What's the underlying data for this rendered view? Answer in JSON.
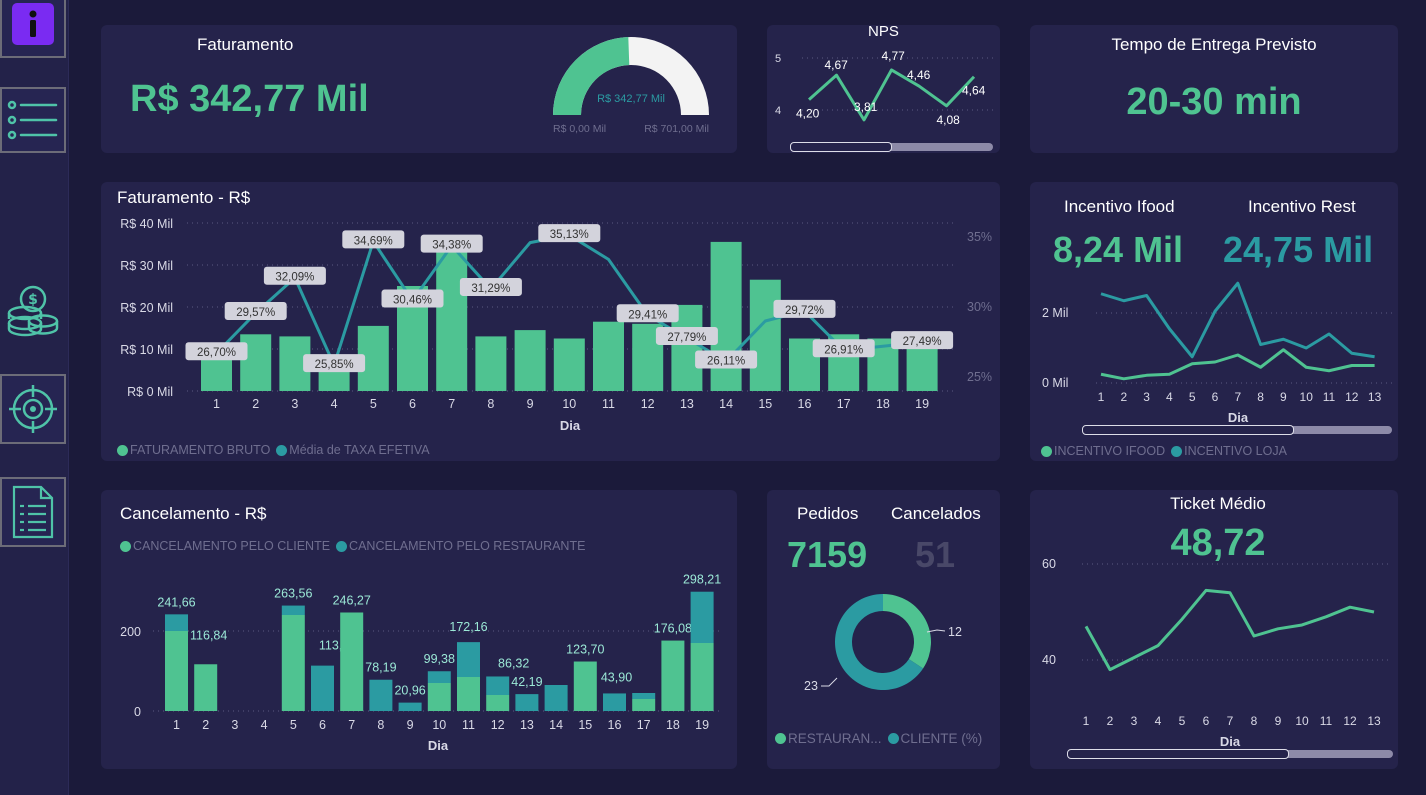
{
  "sidebar": {
    "icons": [
      "info-icon",
      "list-icon",
      "coins-icon",
      "target-icon",
      "document-icon"
    ]
  },
  "faturamento_card": {
    "title": "Faturamento",
    "value": "R$ 342,77 Mil",
    "gauge": {
      "value_label": "R$ 342,77 Mil",
      "min_label": "R$ 0,00 Mil",
      "max_label": "R$ 701,00 Mil",
      "value": 342.77,
      "min": 0,
      "max": 701
    }
  },
  "nps_card": {
    "title": "NPS",
    "y_ticks": [
      "5",
      "4"
    ],
    "chart_data": {
      "type": "line",
      "values": [
        4.2,
        4.67,
        3.81,
        4.77,
        4.46,
        4.08,
        4.64
      ],
      "point_labels": [
        "4,20",
        "4,67",
        "3,81",
        "4,77",
        "4,46",
        "4,08",
        "4,64"
      ],
      "ylim": [
        3.5,
        5.1
      ]
    },
    "scroll_fraction": 0.5
  },
  "tempo_card": {
    "title": "Tempo de Entrega Previsto",
    "value": "20-30 min"
  },
  "fat_chart_card": {
    "title": "Faturamento - R$",
    "xlabel": "Dia",
    "legend": [
      {
        "label": "FATURAMENTO BRUTO",
        "color": "#4fc391"
      },
      {
        "label": "Média de TAXA EFETIVA",
        "color": "#2b9ba2"
      }
    ],
    "chart_data": {
      "type": "bar+line",
      "categories": [
        "1",
        "2",
        "3",
        "4",
        "5",
        "6",
        "7",
        "8",
        "9",
        "10",
        "11",
        "12",
        "13",
        "14",
        "15",
        "16",
        "17",
        "18",
        "19"
      ],
      "y_ticks": [
        "R$ 40 Mil",
        "R$ 30 Mil",
        "R$ 20 Mil",
        "R$ 10 Mil",
        "R$ 0 Mil"
      ],
      "y2_ticks": [
        "35%",
        "30%",
        "25%"
      ],
      "ylim": [
        0,
        40
      ],
      "y2lim": [
        25,
        35
      ],
      "series": [
        {
          "name": "FATURAMENTO BRUTO",
          "values": [
            10.5,
            13.5,
            13,
            7.5,
            15.5,
            25,
            37,
            13,
            14.5,
            12.5,
            16.5,
            16,
            20.5,
            35.5,
            26.5,
            12.5,
            13.5,
            12.5,
            13
          ]
        },
        {
          "name": "Média de TAXA EFETIVA",
          "values": [
            26.7,
            29.57,
            32.09,
            25.85,
            34.69,
            30.46,
            34.38,
            31.29,
            34.6,
            35.13,
            33.4,
            29.41,
            27.79,
            26.11,
            29.0,
            29.72,
            26.91,
            27.2,
            27.49
          ]
        }
      ],
      "data_labels": [
        {
          "i": 0,
          "text": "26,70%"
        },
        {
          "i": 1,
          "text": "29,57%"
        },
        {
          "i": 2,
          "text": "32,09%"
        },
        {
          "i": 3,
          "text": "25,85%"
        },
        {
          "i": 4,
          "text": "34,69%"
        },
        {
          "i": 5,
          "text": "30,46%"
        },
        {
          "i": 6,
          "text": "34,38%"
        },
        {
          "i": 7,
          "text": "31,29%"
        },
        {
          "i": 9,
          "text": "35,13%"
        },
        {
          "i": 11,
          "text": "29,41%"
        },
        {
          "i": 12,
          "text": "27,79%"
        },
        {
          "i": 13,
          "text": "26,11%"
        },
        {
          "i": 15,
          "text": "29,72%"
        },
        {
          "i": 16,
          "text": "26,91%"
        },
        {
          "i": 18,
          "text": "27,49%"
        }
      ]
    }
  },
  "incentivo_card": {
    "title_ifood": "Incentivo Ifood",
    "title_rest": "Incentivo Rest",
    "value_ifood": "8,24 Mil",
    "value_rest": "24,75 Mil",
    "xlabel": "Dia",
    "legend": [
      {
        "label": "INCENTIVO IFOOD",
        "color": "#4fc391"
      },
      {
        "label": "INCENTIVO LOJA",
        "color": "#2b9ba2"
      }
    ],
    "chart_data": {
      "type": "line",
      "categories": [
        "1",
        "2",
        "3",
        "4",
        "5",
        "6",
        "7",
        "8",
        "9",
        "10",
        "11",
        "12",
        "13"
      ],
      "y_ticks": [
        "2 Mil",
        "0 Mil"
      ],
      "ylim": [
        0,
        3
      ],
      "series": [
        {
          "name": "INCENTIVO IFOOD",
          "values": [
            0.25,
            0.12,
            0.22,
            0.25,
            0.55,
            0.6,
            0.8,
            0.45,
            0.95,
            0.45,
            0.35,
            0.5,
            0.5
          ]
        },
        {
          "name": "INCENTIVO LOJA",
          "values": [
            2.55,
            2.35,
            2.5,
            1.55,
            0.75,
            2.05,
            2.85,
            1.1,
            1.25,
            1.0,
            1.4,
            0.85,
            0.75
          ]
        }
      ]
    },
    "scroll_fraction": 0.68
  },
  "cancel_card": {
    "title": "Cancelamento - R$",
    "xlabel": "Dia",
    "legend": [
      {
        "label": "CANCELAMENTO PELO CLIENTE",
        "color": "#4fc391"
      },
      {
        "label": "CANCELAMENTO PELO RESTAURANTE",
        "color": "#2b9ba2"
      }
    ],
    "chart_data": {
      "type": "stacked-bar",
      "categories": [
        "1",
        "2",
        "3",
        "4",
        "5",
        "6",
        "7",
        "8",
        "9",
        "10",
        "11",
        "12",
        "13",
        "14",
        "15",
        "16",
        "17",
        "18",
        "19"
      ],
      "y_ticks": [
        "200",
        "0"
      ],
      "ylim": [
        0,
        300
      ],
      "series": [
        {
          "name": "CANCELAMENTO PELO CLIENTE",
          "values": [
            200,
            116.84,
            0,
            0,
            240,
            0,
            246.27,
            0,
            0,
            70,
            85,
            40,
            0,
            0,
            123.7,
            0,
            30,
            176.08,
            170
          ]
        },
        {
          "name": "CANCELAMENTO PELO RESTAURANTE",
          "values": [
            41.66,
            0,
            0,
            0,
            23.56,
            113.45,
            0,
            78.19,
            20.96,
            29.38,
            87.16,
            46.32,
            42.19,
            65,
            0,
            43.9,
            15,
            0,
            128.21
          ]
        }
      ],
      "totals": [
        "241,66",
        "116,84",
        "",
        "",
        "263,56",
        "113,45",
        "246,27",
        "78,19",
        "20,96",
        "99,38",
        "172,16",
        "86,32",
        "42,19",
        "",
        "123,70",
        "43,90",
        "",
        "176,08",
        "298,21"
      ]
    }
  },
  "pedidos_card": {
    "title_pedidos": "Pedidos",
    "title_cancel": "Cancelados",
    "value_pedidos": "7159",
    "value_cancel": "51",
    "legend": [
      {
        "label": "RESTAURAN...",
        "color": "#4fc391"
      },
      {
        "label": "CLIENTE (%)",
        "color": "#2b9ba2"
      }
    ],
    "chart_data": {
      "type": "pie",
      "values": [
        12,
        23
      ],
      "labels": [
        "12",
        "23"
      ],
      "colors": [
        "#4fc391",
        "#2b9ba2"
      ]
    }
  },
  "ticket_card": {
    "title": "Ticket Médio",
    "value": "48,72",
    "xlabel": "Dia",
    "chart_data": {
      "type": "line",
      "categories": [
        "1",
        "2",
        "3",
        "4",
        "5",
        "6",
        "7",
        "8",
        "9",
        "10",
        "11",
        "12",
        "13"
      ],
      "y_ticks": [
        "60",
        "40"
      ],
      "ylim": [
        35,
        65
      ],
      "values": [
        47,
        38,
        40.5,
        43,
        48.5,
        54.5,
        54,
        45,
        46.5,
        47.3,
        49,
        51,
        50
      ]
    },
    "scroll_fraction": 0.68
  }
}
